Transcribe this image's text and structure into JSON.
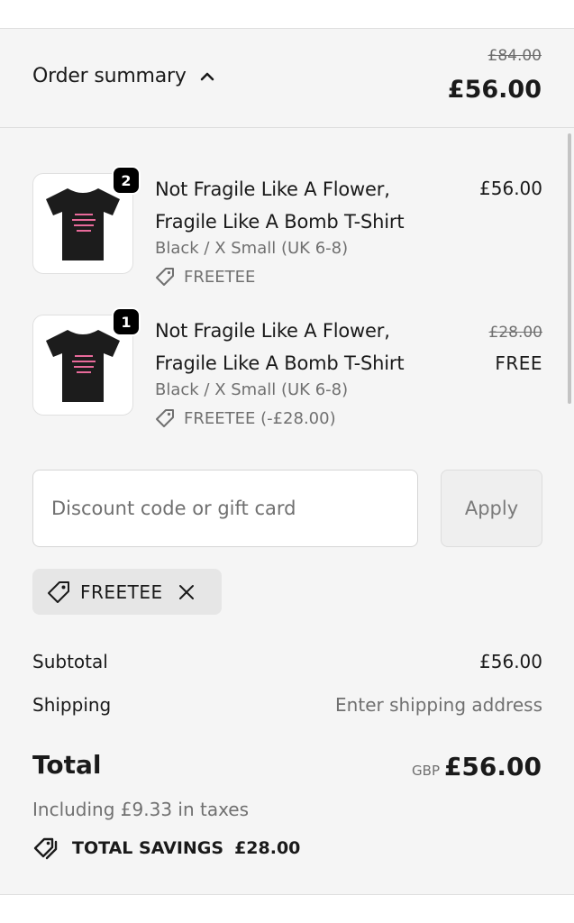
{
  "header": {
    "toggle_label": "Order summary",
    "compare_total": "£84.00",
    "total": "£56.00"
  },
  "items": [
    {
      "quantity": "2",
      "title": "Not Fragile Like A Flower, Fragile Like A Bomb T-Shirt",
      "variant": "Black / X Small (UK 6-8)",
      "discount": "FREETEE",
      "price": "£56.00",
      "shirt_text": "Not Fragile Like a Flower, Fragile like a bomb."
    },
    {
      "quantity": "1",
      "title": "Not Fragile Like A Flower, Fragile Like A Bomb T-Shirt",
      "variant": "Black / X Small (UK 6-8)",
      "discount": "FREETEE (-£28.00)",
      "compare_price": "£28.00",
      "price": "FREE",
      "shirt_text": "Not Fragile Like a Flower, Fragile like a bomb."
    }
  ],
  "discount_form": {
    "placeholder": "Discount code or gift card",
    "value": "",
    "apply_label": "Apply"
  },
  "applied_code": "FREETEE",
  "totals": {
    "subtotal_label": "Subtotal",
    "subtotal_value": "£56.00",
    "shipping_label": "Shipping",
    "shipping_value": "Enter shipping address",
    "total_label": "Total",
    "currency": "GBP",
    "total_value": "£56.00",
    "taxes_note": "Including £9.33 in taxes",
    "savings_label": "TOTAL SAVINGS",
    "savings_value": "£28.00"
  },
  "colors": {
    "panel_bg": "#f5f5f5",
    "badge_bg": "#000000",
    "muted_text": "#707070",
    "shirt_color": "#1c1c1c",
    "shirt_print": "#e86a9a"
  },
  "icons": [
    "chevron-up-icon",
    "tag-icon",
    "close-icon",
    "tags-icon"
  ]
}
